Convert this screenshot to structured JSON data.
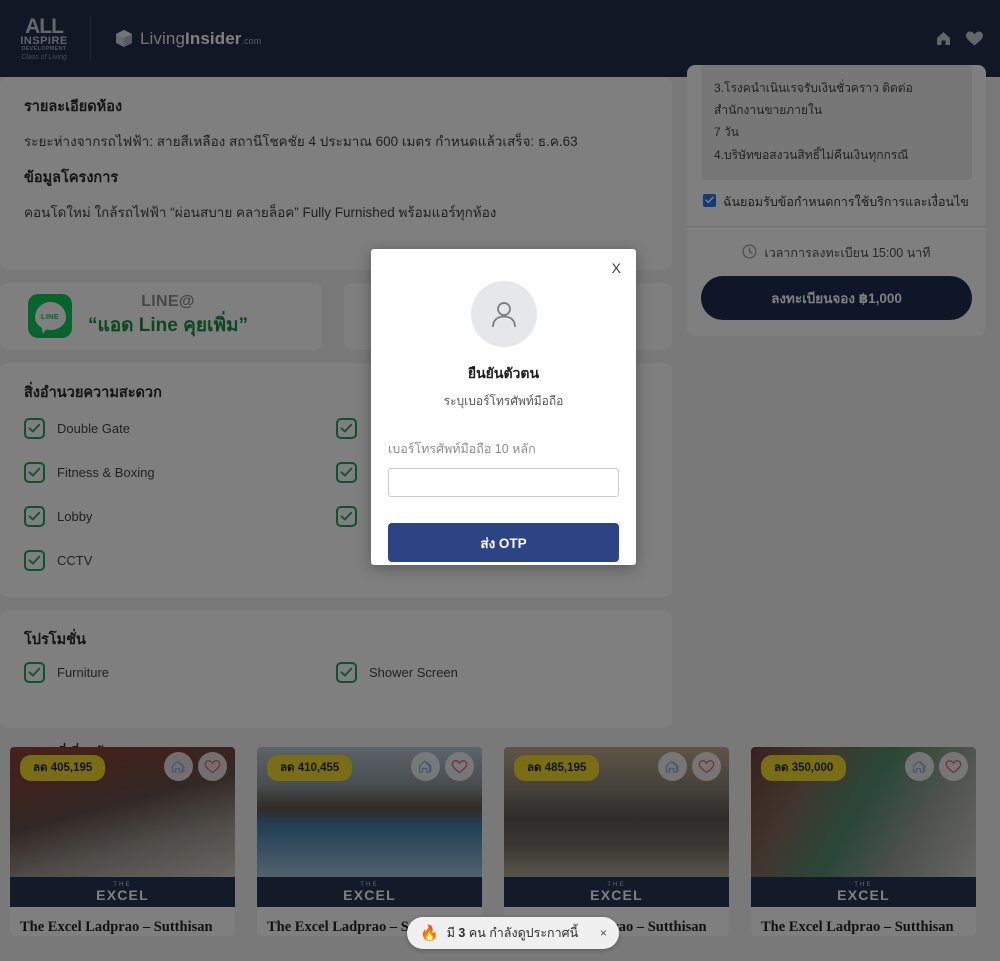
{
  "header": {
    "developer_logo": {
      "mark": "ALL",
      "line1": "INSPIRE",
      "line2": "DEVELOPMENT",
      "tagline": "Class of Living"
    },
    "site_logo": {
      "word1": "Living",
      "word2": "Insider",
      "suffix": ".com"
    },
    "icons": [
      "home-icon",
      "heart-icon"
    ]
  },
  "room_detail": {
    "title": "รายละเอียดห้อง",
    "text": "ระยะห่างจากรถไฟฟ้า: สายสีเหลือง สถานีโชคชัย 4 ประมาณ 600 เมตร กำหนดแล้วเสร็จ: ธ.ค.63"
  },
  "project_info": {
    "title": "ข้อมูลโครงการ",
    "text": "คอนโดใหม่ ใกล้รถไฟฟ้า “ผ่อนสบาย คลายล็อค” Fully Furnished พร้อมแอร์ทุกห้อง"
  },
  "line_promo": {
    "title": "LINE@",
    "subtitle": "“แอด Line คุยเพิ่ม”",
    "badge_text": "LINE"
  },
  "amenities": {
    "title": "สิ่งอำนวยความสะดวก",
    "items": [
      {
        "label": "Double Gate",
        "checked": true
      },
      {
        "label": "",
        "checked": true
      },
      {
        "label": "Fitness & Boxing",
        "checked": true
      },
      {
        "label": "",
        "checked": true
      },
      {
        "label": "Lobby",
        "checked": true
      },
      {
        "label": "",
        "checked": true
      },
      {
        "label": "CCTV",
        "checked": true
      },
      {
        "label": "",
        "checked": false
      }
    ]
  },
  "promotion": {
    "title": "โปรโมชั่น",
    "items": [
      {
        "label": "Furniture",
        "checked": true
      },
      {
        "label": "Shower Screen",
        "checked": true
      }
    ]
  },
  "related": {
    "title": "ประกาศที่เกี่ยวข้อง",
    "cards": [
      {
        "badge": "ลด 405,195",
        "brand_the": "THE",
        "brand_name": "EXCEL",
        "title": "The Excel Ladprao – Sutthisan",
        "photo": "ph1"
      },
      {
        "badge": "ลด 410,455",
        "brand_the": "THE",
        "brand_name": "EXCEL",
        "title": "The Excel Ladprao – Sutthisan",
        "photo": "ph2"
      },
      {
        "badge": "ลด 485,195",
        "brand_the": "THE",
        "brand_name": "EXCEL",
        "title": "The Excel Ladprao – Sutthisan",
        "photo": "ph3"
      },
      {
        "badge": "ลด 350,000",
        "brand_the": "THE",
        "brand_name": "EXCEL",
        "title": "The Excel Ladprao – Sutthisan",
        "photo": "ph4"
      }
    ]
  },
  "booking": {
    "terms": [
      "3.โรงคนำเนินเรจรับเงินชั่วคราว ติดต่อสำนักงานขายภายใน",
      "7 วัน",
      "4.บริษัทขอสงวนสิทธิ์ไม่คืนเงินทุกกรณี"
    ],
    "agree_label": "ฉันยอมรับข้อกำหนดการใช้บริการและเงื่อนไข",
    "agree_checked": true,
    "timer_label": "เวลาการลงทะเบียน 15:00 นาที",
    "book_button": "ลงทะเบียนจอง ฿1,000"
  },
  "modal": {
    "close_label": "X",
    "title": "ยืนยันตัวตน",
    "subtitle": "ระบุเบอร์โทรศัพท์มือถือ",
    "field_label": "เบอร์โทรศัพท์มือถือ 10 หลัก",
    "field_value": "",
    "field_placeholder": "",
    "submit_label": "ส่ง OTP"
  },
  "toast": {
    "icon": "🔥",
    "prefix": "มี ",
    "count": "3",
    "suffix": " คน กำลังดูประกาศนี้",
    "close_label": "×"
  },
  "colors": {
    "header_bg": "#1c2746",
    "primary_button": "#132447",
    "modal_button": "#2c4484",
    "checkbox_green": "#16a05a",
    "badge_yellow": "#f2dc22",
    "line_green": "#06C755",
    "agree_blue": "#1a73e8"
  }
}
